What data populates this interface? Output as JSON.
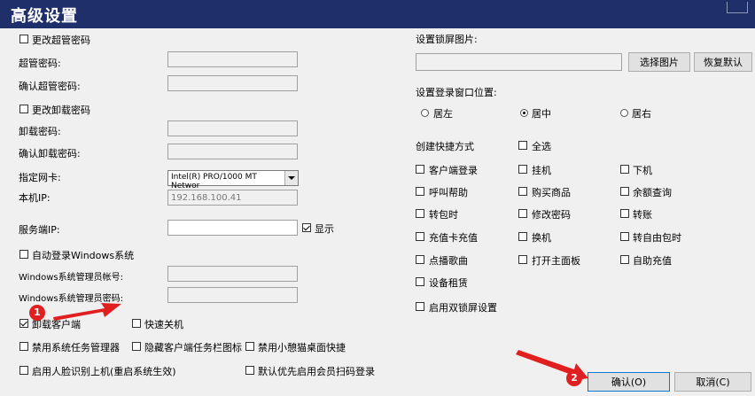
{
  "title": "高级设置",
  "left": {
    "change_admin_pwd": "更改超管密码",
    "admin_pwd_label": "超管密码:",
    "confirm_admin_pwd_label": "确认超管密码:",
    "change_uninstall_pwd": "更改卸载密码",
    "uninstall_pwd_label": "卸载密码:",
    "confirm_uninstall_pwd_label": "确认卸载密码:",
    "nic_label": "指定网卡:",
    "nic_value": "Intel(R) PRO/1000 MT Networ",
    "local_ip_label": "本机IP:",
    "local_ip_value": "192.168.100.41",
    "server_ip_label": "服务端IP:",
    "show_label": "显示",
    "auto_login_windows": "自动登录Windows系统",
    "win_admin_account_label": "Windows系统管理员帐号:",
    "win_admin_pwd_label": "Windows系统管理员密码:",
    "uninstall_client": "卸载客户端",
    "fast_shutdown": "快速关机",
    "disable_task_manager": "禁用系统任务管理器",
    "hide_client_taskbar_icon": "隐藏客户端任务栏图标",
    "disable_desktop_shortcut": "禁用小憩猫桌面快捷",
    "face_recognition": "启用人脸识别上机(重启系统生效)",
    "default_member_scan": "默认优先启用会员扫码登录"
  },
  "right": {
    "lockscreen_label": "设置锁屏图片:",
    "choose_image": "选择图片",
    "restore_default": "恢复默认",
    "login_window_pos_label": "设置登录窗口位置:",
    "pos_left": "居左",
    "pos_center": "居中",
    "pos_right": "居右",
    "shortcut_label": "创建快捷方式",
    "select_all": "全选",
    "shortcuts": [
      "客户端登录",
      "挂机",
      "下机",
      "呼叫帮助",
      "购买商品",
      "余额查询",
      "转包时",
      "修改密码",
      "转账",
      "充值卡充值",
      "换机",
      "转自由包时",
      "点播歌曲",
      "打开主面板",
      "自助充值",
      "设备租赁"
    ],
    "dual_lockscreen": "启用双锁屏设置"
  },
  "footer": {
    "confirm": "确认(O)",
    "cancel": "取消(C)"
  },
  "annotations": {
    "marker1": "1",
    "marker2": "2"
  },
  "colors": {
    "titlebar": "#1f2f6a",
    "annotation": "#e02020"
  }
}
